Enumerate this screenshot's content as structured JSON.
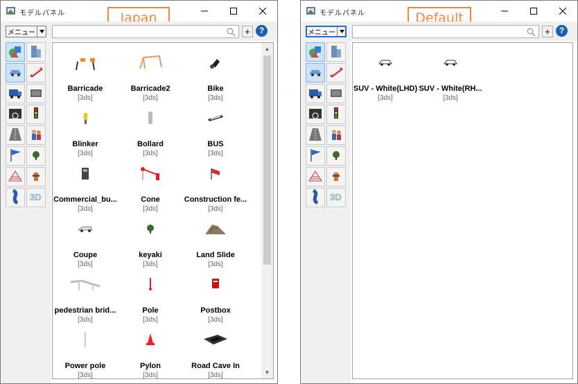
{
  "panels": [
    {
      "id": "japan",
      "window_title": "モデルパネル",
      "tag_label": "Japan",
      "menu_label": "メニュー",
      "search": {
        "placeholder": ""
      },
      "add_label": "+",
      "help_label": "?",
      "items": [
        {
          "name": "Barricade",
          "type": "[3ds]",
          "icon": "barricade-icon"
        },
        {
          "name": "Barricade2",
          "type": "[3ds]",
          "icon": "barricade2-icon"
        },
        {
          "name": "Bike",
          "type": "[3ds]",
          "icon": "bike-icon"
        },
        {
          "name": "Blinker",
          "type": "[3ds]",
          "icon": "blinker-icon"
        },
        {
          "name": "Bollard",
          "type": "[3ds]",
          "icon": "bollard-icon"
        },
        {
          "name": "BUS",
          "type": "[3ds]",
          "icon": "bus-icon"
        },
        {
          "name": "Commercial_bu...",
          "type": "[3ds]",
          "icon": "commercial-building-icon"
        },
        {
          "name": "Cone",
          "type": "[3ds]",
          "icon": "cone-icon"
        },
        {
          "name": "Construction fe...",
          "type": "[3ds]",
          "icon": "construction-fence-icon"
        },
        {
          "name": "Coupe",
          "type": "[3ds]",
          "icon": "coupe-icon"
        },
        {
          "name": "keyaki",
          "type": "[3ds]",
          "icon": "tree-icon"
        },
        {
          "name": "Land Slide",
          "type": "[3ds]",
          "icon": "landslide-icon"
        },
        {
          "name": "pedestrian brid...",
          "type": "[3ds]",
          "icon": "pedestrian-bridge-icon"
        },
        {
          "name": "Pole",
          "type": "[3ds]",
          "icon": "pole-icon"
        },
        {
          "name": "Postbox",
          "type": "[3ds]",
          "icon": "postbox-icon"
        },
        {
          "name": "Power pole",
          "type": "[3ds]",
          "icon": "power-pole-icon"
        },
        {
          "name": "Pylon",
          "type": "[3ds]",
          "icon": "pylon-icon"
        },
        {
          "name": "Road Cave In",
          "type": "[3ds]",
          "icon": "road-cave-in-icon"
        }
      ]
    },
    {
      "id": "default",
      "window_title": "モデルパネル",
      "tag_label": "Default",
      "menu_label": "メニュー",
      "search": {
        "placeholder": ""
      },
      "add_label": "+",
      "help_label": "?",
      "items": [
        {
          "name": "SUV - White(LHD)",
          "type": "[3ds]",
          "icon": "suv-icon"
        },
        {
          "name": "SUV - White(RH...",
          "type": "[3ds]",
          "icon": "suv-icon"
        }
      ]
    }
  ],
  "categories": [
    {
      "icon": "shapes-icon"
    },
    {
      "icon": "building-icon"
    },
    {
      "icon": "car-icon"
    },
    {
      "icon": "train-icon"
    },
    {
      "icon": "truck-icon"
    },
    {
      "icon": "container-icon"
    },
    {
      "icon": "driver-view-icon"
    },
    {
      "icon": "traffic-light-icon"
    },
    {
      "icon": "road-icon"
    },
    {
      "icon": "people-icon"
    },
    {
      "icon": "flag-icon"
    },
    {
      "icon": "tree-icon"
    },
    {
      "icon": "grid-terrain-icon"
    },
    {
      "icon": "hydrant-icon"
    },
    {
      "icon": "curve-road-icon"
    },
    {
      "icon": "3d-icon"
    }
  ],
  "colors": {
    "accent": "#f0883c",
    "selected": "#cce4f7",
    "help": "#1a5fb4"
  }
}
